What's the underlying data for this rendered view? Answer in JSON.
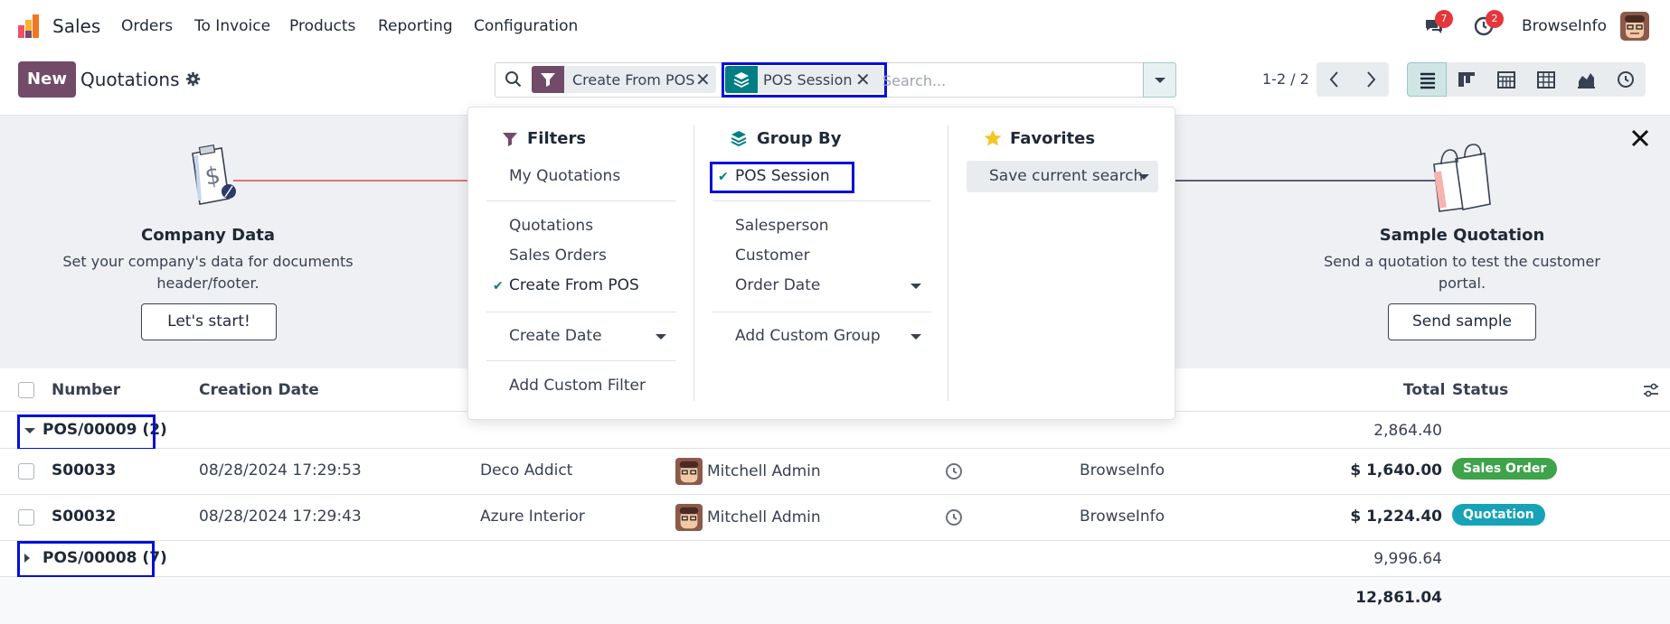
{
  "navbar": {
    "app_name": "Sales",
    "menu": [
      "Orders",
      "To Invoice",
      "Products",
      "Reporting",
      "Configuration"
    ],
    "messages_count": "7",
    "activities_count": "2",
    "company": "BrowseInfo"
  },
  "control_panel": {
    "new_label": "New",
    "title": "Quotations",
    "facets": [
      {
        "label": "Create From POS",
        "icon": "filter-icon",
        "color": "#714b67"
      },
      {
        "label": "POS Session",
        "icon": "layers-icon",
        "color": "#017e84"
      }
    ],
    "search_placeholder": "Search...",
    "pager": "1-2 / 2",
    "views": [
      "list-view-icon",
      "kanban-view-icon",
      "calendar-view-icon",
      "pivot-view-icon",
      "graph-view-icon",
      "activity-view-icon"
    ]
  },
  "banner": {
    "steps": [
      {
        "title": "Company Data",
        "desc_line1": "Set your company's data for documents",
        "desc_line2": "header/footer.",
        "button": "Let's start!"
      },
      {
        "title": "Sample Quotation",
        "desc_line1": "Send a quotation to test the customer",
        "desc_line2": "portal.",
        "button": "Send sample"
      }
    ]
  },
  "dropdown": {
    "filters": {
      "title": "Filters",
      "items": [
        "My Quotations",
        "Quotations",
        "Sales Orders",
        "Create From POS",
        "Create Date",
        "Add Custom Filter"
      ]
    },
    "group_by": {
      "title": "Group By",
      "items": [
        "POS Session",
        "Salesperson",
        "Customer",
        "Order Date",
        "Add Custom Group"
      ]
    },
    "favorites": {
      "title": "Favorites",
      "save_label": "Save current search"
    }
  },
  "list": {
    "columns": {
      "number": "Number",
      "creation_date": "Creation Date",
      "total": "Total",
      "status": "Status"
    },
    "groups": [
      {
        "label": "POS/00009 (2)",
        "total": "2,864.40",
        "expanded": true,
        "rows": [
          {
            "number": "S00033",
            "date": "08/28/2024 17:29:53",
            "customer": "Deco Addict",
            "salesperson": "Mitchell Admin",
            "company": "BrowseInfo",
            "total": "$ 1,640.00",
            "status": "Sales Order",
            "status_color": "#3ea34a"
          },
          {
            "number": "S00032",
            "date": "08/28/2024 17:29:43",
            "customer": "Azure Interior",
            "salesperson": "Mitchell Admin",
            "company": "BrowseInfo",
            "total": "$ 1,224.40",
            "status": "Quotation",
            "status_color": "#17a2b8"
          }
        ]
      },
      {
        "label": "POS/00008 (7)",
        "total": "9,996.64",
        "expanded": false,
        "rows": []
      }
    ],
    "grand_total": "12,861.04"
  },
  "colors": {
    "primary": "#714b67",
    "accent": "#017e84",
    "highlight": "#0010d9"
  }
}
